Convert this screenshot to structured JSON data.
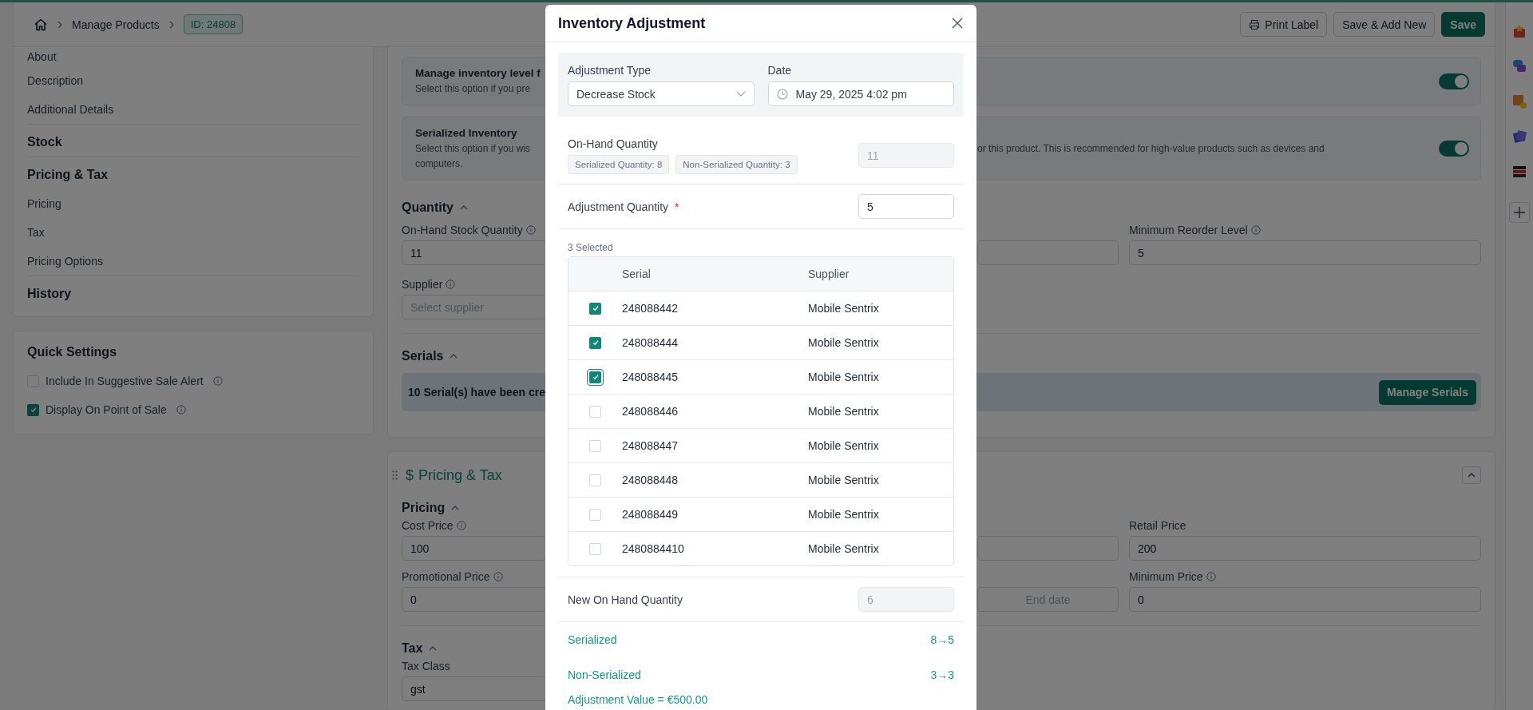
{
  "header": {
    "breadcrumb": "Manage Products",
    "badge": "ID: 24808",
    "buttons": [
      {
        "label": "Print Label",
        "kind": "print"
      },
      {
        "label": "Save & Add New",
        "kind": "outline"
      },
      {
        "label": "Save",
        "kind": "primary"
      }
    ]
  },
  "sidebar": {
    "items": [
      {
        "label": "About",
        "kind": "link"
      },
      {
        "label": "Description",
        "kind": "link"
      },
      {
        "label": "Additional Details",
        "kind": "link"
      },
      {
        "label": "Stock",
        "kind": "section"
      },
      {
        "label": "Pricing & Tax",
        "kind": "section"
      },
      {
        "label": "Pricing",
        "kind": "link"
      },
      {
        "label": "Tax",
        "kind": "link"
      },
      {
        "label": "Pricing Options",
        "kind": "link"
      },
      {
        "label": "History",
        "kind": "section"
      }
    ]
  },
  "quick_settings": {
    "title": "Quick Settings",
    "items": [
      {
        "label": "Include In Suggestive Sale Alert",
        "checked": false
      },
      {
        "label": "Display On Point of Sale",
        "checked": true
      }
    ]
  },
  "inventory": {
    "options": [
      {
        "title": "Manage inventory level f",
        "description": "Select this option if you pre",
        "on": true
      },
      {
        "title": "Serialized Inventory",
        "description": "Select this option if you wis",
        "description_right": "or this product. This is recommended for high-value products such as devices and",
        "description_more": "computers.",
        "on": true
      }
    ],
    "quantity_heading": "Quantity",
    "on_hand": {
      "label": "On-Hand Stock Quantity",
      "value": "11"
    },
    "minimum_reorder": {
      "label": "Minimum Reorder Level",
      "value": "5"
    },
    "supplier": {
      "label": "Supplier",
      "placeholder": "Select supplier"
    },
    "serials_heading": "Serials",
    "serials_banner": "10 Serial(s) have been cre",
    "manage_button": "Manage Serials"
  },
  "pricing": {
    "icon": "$",
    "title": "Pricing & Tax",
    "pricing_heading": "Pricing",
    "cost_price": {
      "label": "Cost Price",
      "value": "100"
    },
    "retail_price": {
      "label": "Retail Price",
      "value": "200"
    },
    "promotional_price": {
      "label": "Promotional Price",
      "value": "0"
    },
    "end_date": {
      "placeholder": "End date"
    },
    "minimum_price": {
      "label": "Minimum Price",
      "value": "0"
    },
    "tax_heading": "Tax",
    "tax_class": {
      "label": "Tax Class",
      "value": "gst"
    }
  },
  "modal": {
    "title": "Inventory Adjustment",
    "adjustment_type": {
      "label": "Adjustment Type",
      "value": "Decrease Stock"
    },
    "date": {
      "label": "Date",
      "value": "May 29, 2025 4:02 pm"
    },
    "on_hand": {
      "label": "On-Hand Quantity",
      "chips": [
        "Serialized Quantity: 8",
        "Non-Serialized Quantity: 3"
      ],
      "value": "11",
      "disabled": true
    },
    "adjustment_quantity": {
      "label": "Adjustment Quantity",
      "required_mark": "*",
      "value": "5",
      "disabled": false
    },
    "selected_count": "3 Selected",
    "table": {
      "columns": [
        "Serial",
        "Supplier"
      ],
      "rows": [
        {
          "serial": "248088442",
          "supplier": "Mobile Sentrix",
          "selected": true,
          "focused": false
        },
        {
          "serial": "248088444",
          "supplier": "Mobile Sentrix",
          "selected": true,
          "focused": false
        },
        {
          "serial": "248088445",
          "supplier": "Mobile Sentrix",
          "selected": true,
          "focused": true
        },
        {
          "serial": "248088446",
          "supplier": "Mobile Sentrix",
          "selected": false,
          "focused": false
        },
        {
          "serial": "248088447",
          "supplier": "Mobile Sentrix",
          "selected": false,
          "focused": false
        },
        {
          "serial": "248088448",
          "supplier": "Mobile Sentrix",
          "selected": false,
          "focused": false
        },
        {
          "serial": "248088449",
          "supplier": "Mobile Sentrix",
          "selected": false,
          "focused": false
        },
        {
          "serial": "2480884410",
          "supplier": "Mobile Sentrix",
          "selected": false,
          "focused": false
        }
      ]
    },
    "new_on_hand": {
      "label": "New On Hand Quantity",
      "value": "6",
      "disabled": true
    },
    "summary": [
      {
        "label": "Serialized",
        "value": "8→5"
      },
      {
        "label": "Non-Serialized",
        "value": "3→3"
      }
    ],
    "adjustment_value": "Adjustment Value = €500.00"
  }
}
